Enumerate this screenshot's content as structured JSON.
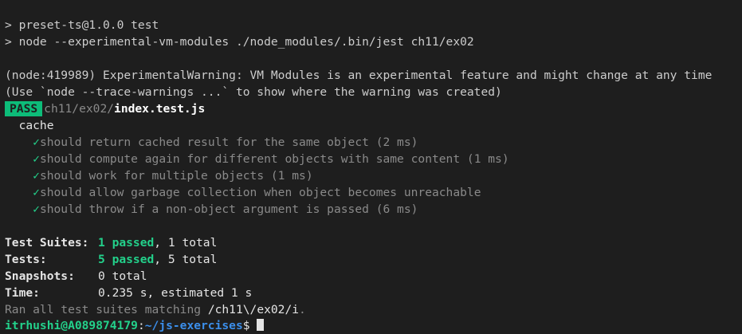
{
  "npm": {
    "line1": "> preset-ts@1.0.0 test",
    "line2": "> node --experimental-vm-modules ./node_modules/.bin/jest ch11/ex02"
  },
  "warning": {
    "line1": "(node:419989) ExperimentalWarning: VM Modules is an experimental feature and might change at any time",
    "line2": "(Use `node --trace-warnings ...` to show where the warning was created)"
  },
  "suite": {
    "status": "PASS",
    "path": "ch11/ex02/",
    "file": "index.test.js",
    "group": "cache",
    "check_glyph": "✓",
    "tests": [
      "should return cached result for the same object (2 ms)",
      "should compute again for different objects with same content (1 ms)",
      "should work for multiple objects (1 ms)",
      "should allow garbage collection when object becomes unreachable",
      "should throw if a non-object argument is passed (6 ms)"
    ]
  },
  "summary": {
    "suites_label": "Test Suites:",
    "suites_passed": "1 passed",
    "suites_total": ", 1 total",
    "tests_label": "Tests:",
    "tests_passed": "5 passed",
    "tests_total": ", 5 total",
    "snapshots_label": "Snapshots:",
    "snapshots_value": "0 total",
    "time_label": "Time:",
    "time_value": "0.235 s, estimated 1 s",
    "ran_prefix": "Ran all test suites matching ",
    "ran_pattern": "/ch11\\/ex02/i",
    "ran_suffix": "."
  },
  "prompt": {
    "user": "itrhushi@A089874179",
    "sep": ":",
    "path": "~/js-exercises",
    "symbol": "$ "
  },
  "colors": {
    "background": "#1e1e1e",
    "pass_badge": "#0dbc79",
    "green": "#23d18b",
    "blue": "#3b8eea"
  }
}
